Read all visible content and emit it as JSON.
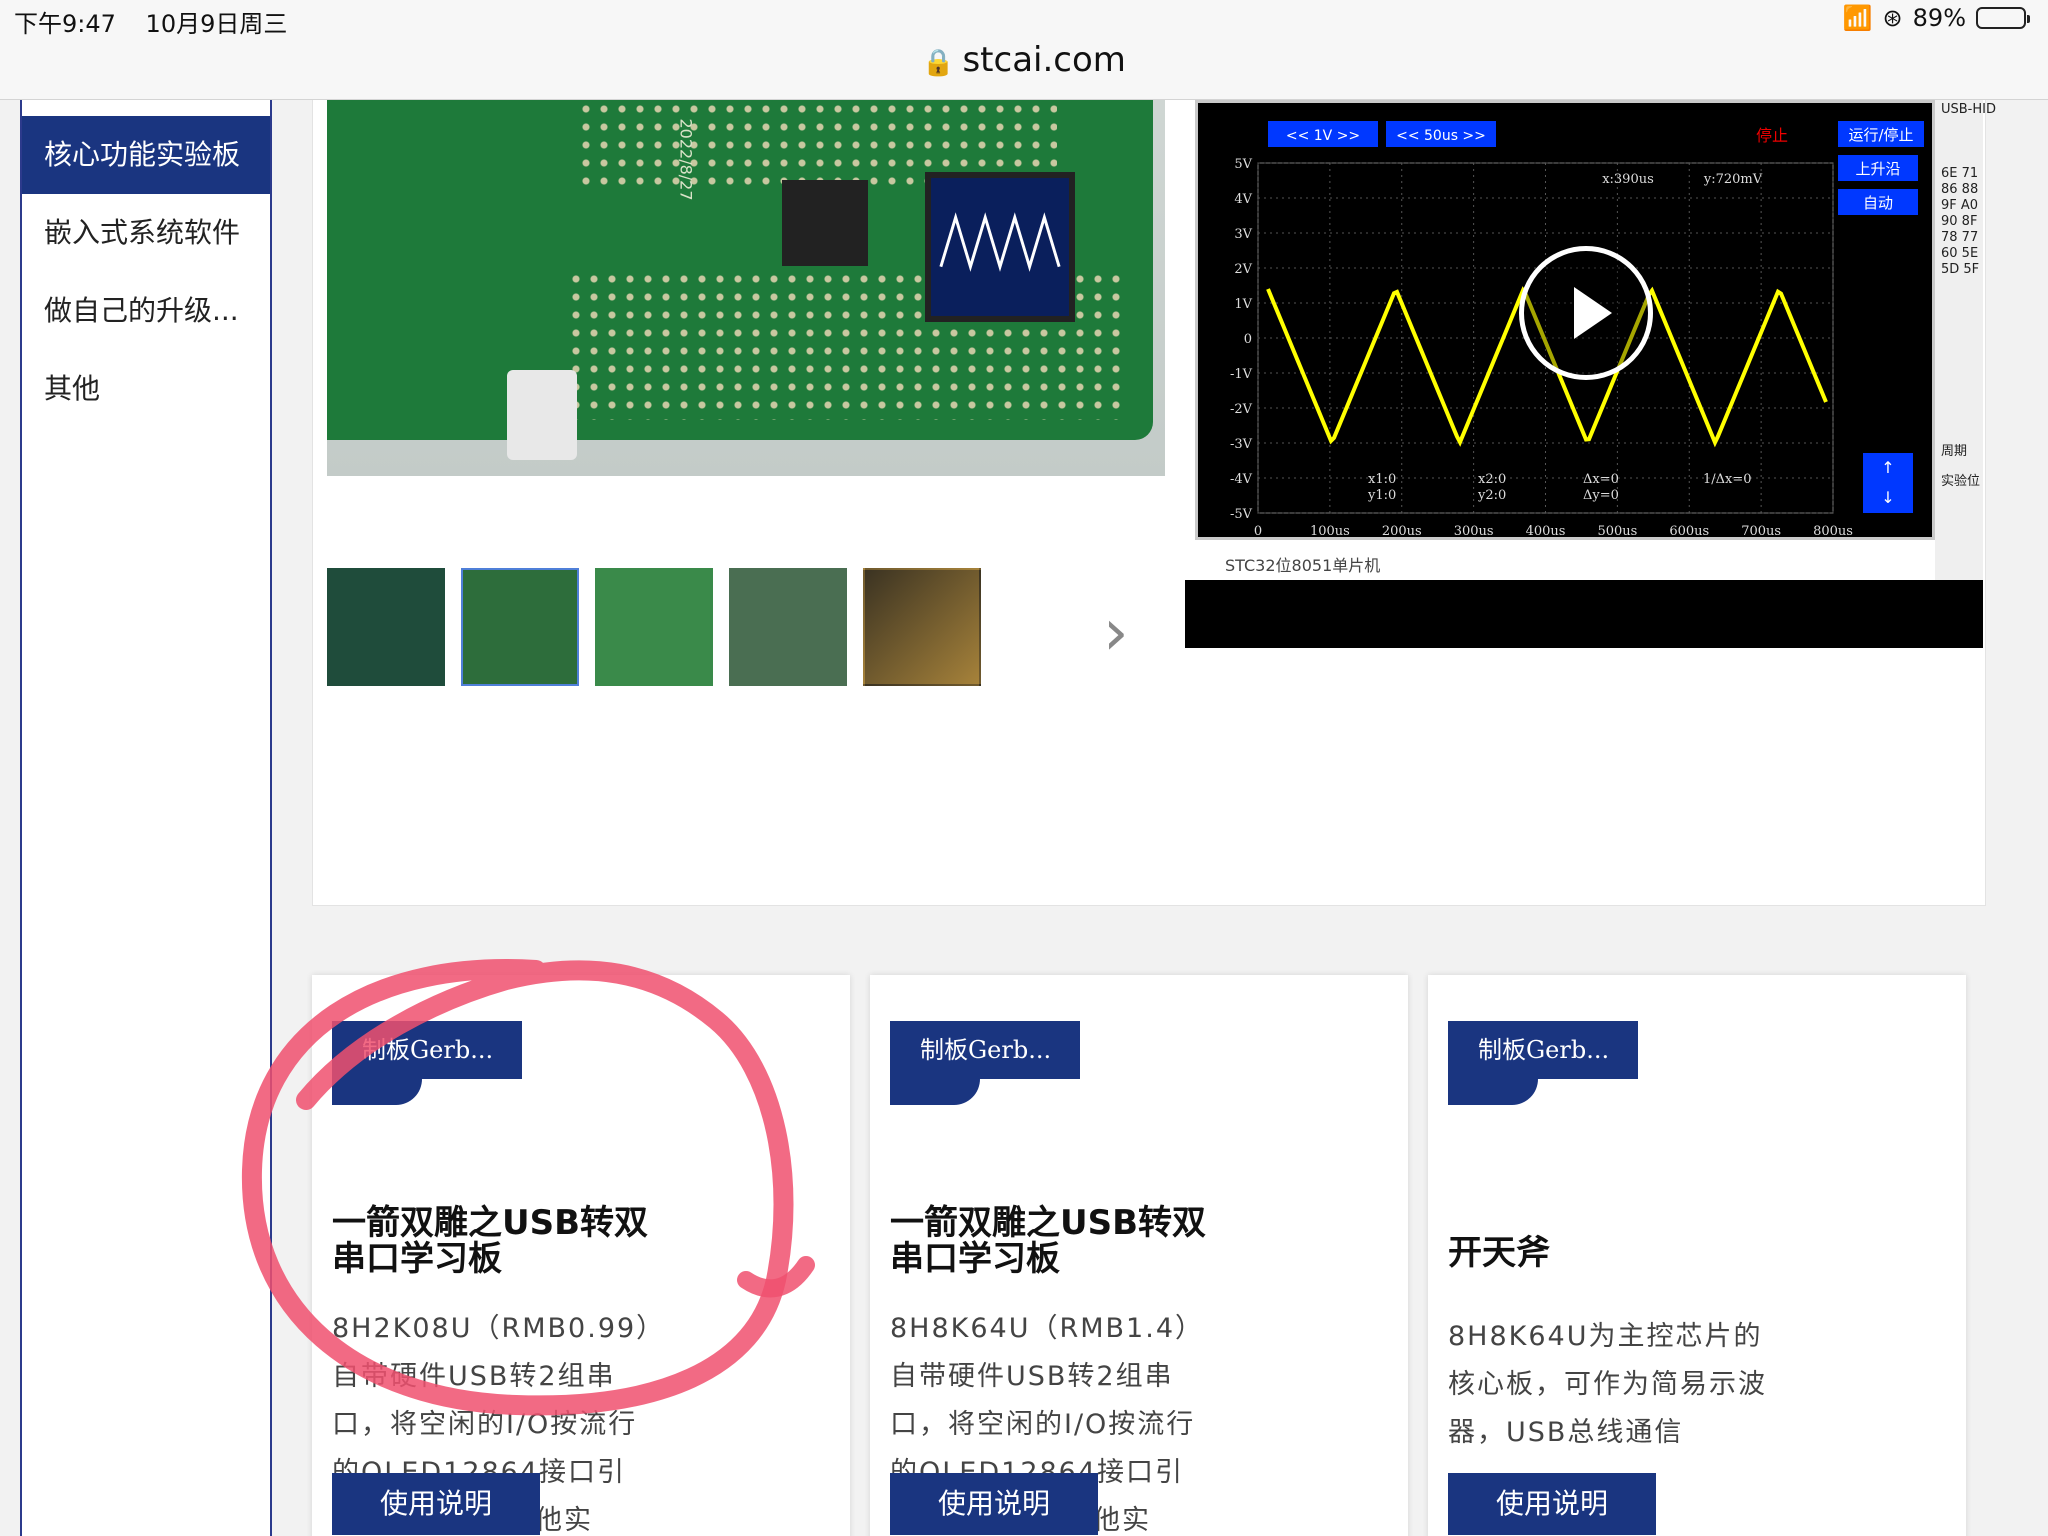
{
  "status": {
    "time": "下午9:47",
    "date": "10月9日周三",
    "battery": "89%",
    "battery_level": 0.89
  },
  "browser": {
    "url": "stcai.com"
  },
  "sidebar": {
    "items": [
      {
        "label": "核心功能实验板",
        "active": true
      },
      {
        "label": "嵌入式系统软件"
      },
      {
        "label": "做自己的升级..."
      },
      {
        "label": "其他"
      }
    ]
  },
  "gallery": {
    "board_text": "2022/8/27",
    "video_caption": "STC32位8051单片机",
    "scope": {
      "btn_1v": "1V",
      "btn_50us": "50us",
      "stop": "停止",
      "run_stop": "运行/停止",
      "rising": "上升沿",
      "auto": "自动",
      "x_readout": "x:390us",
      "y_readout": "y:720mV",
      "y_ticks": [
        "5V",
        "4V",
        "3V",
        "2V",
        "1V",
        "0",
        "-1V",
        "-2V",
        "-3V",
        "-4V",
        "-5V"
      ],
      "x_ticks": [
        "0",
        "100us",
        "200us",
        "300us",
        "400us",
        "500us",
        "600us",
        "700us",
        "800us"
      ],
      "cursor_readouts": [
        "x1:0",
        "y1:0",
        "x2:0",
        "y2:0",
        "Δx=0",
        "Δy=0",
        "1/Δx=0"
      ],
      "side_panel": [
        "USB-HID",
        "6E 71",
        "86 88",
        "9F A0",
        "90 8F",
        "78 77",
        "60 5E",
        "5D 5F",
        "周期",
        "实验位"
      ]
    }
  },
  "cards": [
    {
      "tag": "制板Gerb...",
      "title": "一箭双雕之USB转双串口学习板",
      "desc": "8H2K08U（RMB0.99）自带硬件USB转2组串口，将空闲的I/O按流行的OLED12864接口引出，可做各种其他实",
      "button": "使用说明"
    },
    {
      "tag": "制板Gerb...",
      "title": "一箭双雕之USB转双串口学习板",
      "desc": "8H8K64U（RMB1.4）自带硬件USB转2组串口，将空闲的I/O按流行的OLED12864接口引出，可做各种其他实",
      "button": "使用说明"
    },
    {
      "tag": "制板Gerb...",
      "title": "开天斧",
      "desc": "8H8K64U为主控芯片的核心板，可作为简易示波器，USB总线通信",
      "button": "使用说明"
    }
  ]
}
